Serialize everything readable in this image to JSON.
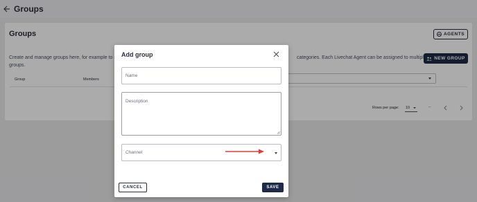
{
  "header": {
    "title": "Groups",
    "back_icon": "arrow-left-icon"
  },
  "card": {
    "title": "Groups",
    "description_left": "Create and manage groups here, for example to a",
    "description_right": "categories. Each Livechat Agent can be assigned to multiple",
    "description_line2": "groups.",
    "agents_button": "AGENTS",
    "new_group_button": "NEW GROUP",
    "columns": [
      "Group",
      "Members"
    ],
    "pagination": {
      "rows_per_page_label": "Rows per page:",
      "rows_per_page_value": "10",
      "range": "–"
    }
  },
  "modal": {
    "title": "Add group",
    "name_placeholder": "Name",
    "description_placeholder": "Description",
    "channel_label": "Channel",
    "cancel_button": "CANCEL",
    "save_button": "SAVE"
  },
  "colors": {
    "primary": "#1e2a48",
    "annotation_arrow": "#e53935",
    "overlay": "rgba(0,0,0,0.33)"
  }
}
